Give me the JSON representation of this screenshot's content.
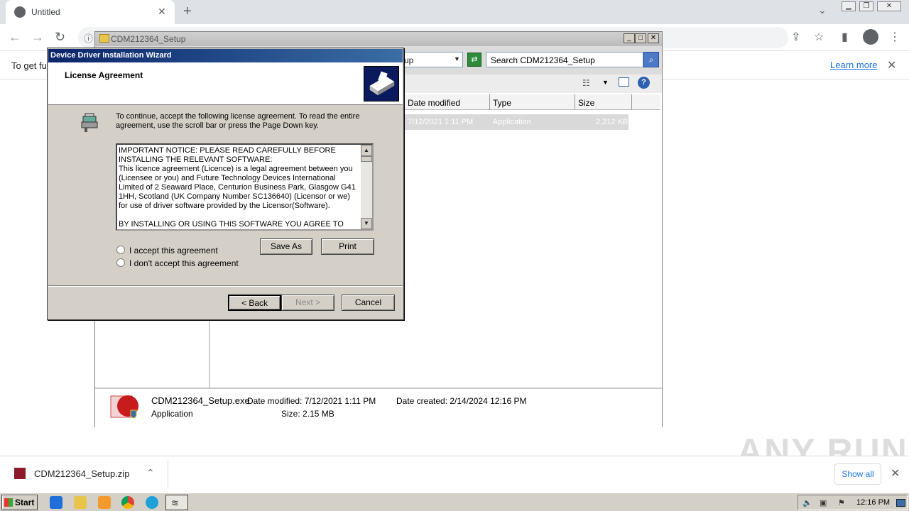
{
  "browser": {
    "tab_title": "Untitled",
    "new_tab": "+",
    "tab_close": "✕",
    "info_message": "To get fu",
    "learn_more": "Learn more",
    "download_file": "CDM212364_Setup.zip",
    "show_all": "Show all"
  },
  "explorer": {
    "title": "CDM212364_Setup",
    "address_value": "up",
    "search_placeholder": "Search CDM212364_Setup",
    "columns": [
      "Date modified",
      "Type",
      "Size"
    ],
    "file_row": {
      "date": "7/12/2021 1:11 PM",
      "type": "Application",
      "size": "2,212 KB"
    },
    "details": {
      "name": "CDM212364_Setup.exe",
      "type": "Application",
      "date_modified": "Date modified: 7/12/2021 1:11 PM",
      "size": "Size: 2.15 MB",
      "date_created": "Date created: 2/14/2024 12:16 PM"
    }
  },
  "wizard": {
    "title": "Device Driver Installation Wizard",
    "heading": "License Agreement",
    "instructions": "To continue, accept the following license agreement. To read the entire agreement, use the scroll bar or press the Page Down key.",
    "license_lines": [
      "IMPORTANT NOTICE: PLEASE READ CAREFULLY BEFORE INSTALLING THE RELEVANT SOFTWARE:",
      "This licence agreement (Licence) is a legal agreement between you (Licensee or you) and Future Technology Devices International Limited of 2 Seaward Place, Centurion Business Park, Glasgow G41 1HH, Scotland (UK Company Number SC136640) (Licensor or we) for use of driver software provided by the Licensor(Software).",
      "",
      "BY INSTALLING OR USING THIS SOFTWARE YOU AGREE TO THE"
    ],
    "accept_label": "I accept this agreement",
    "decline_label": "I don't accept this agreement",
    "save_as": "Save As",
    "print": "Print",
    "back": "< Back",
    "next": "Next >",
    "cancel": "Cancel"
  },
  "taskbar": {
    "start": "Start",
    "clock": "12:16 PM"
  },
  "watermark": "ANY RUN"
}
